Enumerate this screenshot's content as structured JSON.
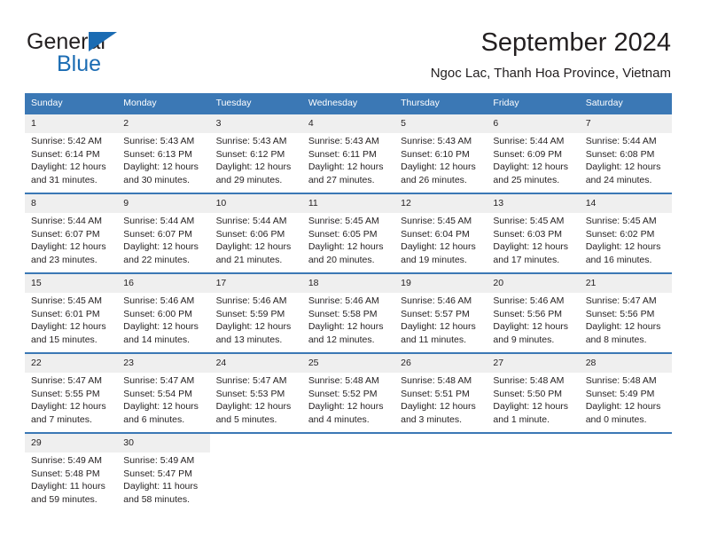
{
  "brand": {
    "word1": "General",
    "word2": "Blue",
    "triangle_color": "#1b6cb3"
  },
  "header": {
    "title": "September 2024",
    "subtitle": "Ngoc Lac, Thanh Hoa Province, Vietnam"
  },
  "theme": {
    "header_bg": "#3b78b5",
    "daynum_bg": "#efefef",
    "text": "#231f20",
    "accent": "#1b6cb3"
  },
  "calendar": {
    "weekday_headers": [
      "Sunday",
      "Monday",
      "Tuesday",
      "Wednesday",
      "Thursday",
      "Friday",
      "Saturday"
    ],
    "weeks": [
      [
        {
          "day": "1",
          "sunrise": "Sunrise: 5:42 AM",
          "sunset": "Sunset: 6:14 PM",
          "daylight1": "Daylight: 12 hours",
          "daylight2": "and 31 minutes."
        },
        {
          "day": "2",
          "sunrise": "Sunrise: 5:43 AM",
          "sunset": "Sunset: 6:13 PM",
          "daylight1": "Daylight: 12 hours",
          "daylight2": "and 30 minutes."
        },
        {
          "day": "3",
          "sunrise": "Sunrise: 5:43 AM",
          "sunset": "Sunset: 6:12 PM",
          "daylight1": "Daylight: 12 hours",
          "daylight2": "and 29 minutes."
        },
        {
          "day": "4",
          "sunrise": "Sunrise: 5:43 AM",
          "sunset": "Sunset: 6:11 PM",
          "daylight1": "Daylight: 12 hours",
          "daylight2": "and 27 minutes."
        },
        {
          "day": "5",
          "sunrise": "Sunrise: 5:43 AM",
          "sunset": "Sunset: 6:10 PM",
          "daylight1": "Daylight: 12 hours",
          "daylight2": "and 26 minutes."
        },
        {
          "day": "6",
          "sunrise": "Sunrise: 5:44 AM",
          "sunset": "Sunset: 6:09 PM",
          "daylight1": "Daylight: 12 hours",
          "daylight2": "and 25 minutes."
        },
        {
          "day": "7",
          "sunrise": "Sunrise: 5:44 AM",
          "sunset": "Sunset: 6:08 PM",
          "daylight1": "Daylight: 12 hours",
          "daylight2": "and 24 minutes."
        }
      ],
      [
        {
          "day": "8",
          "sunrise": "Sunrise: 5:44 AM",
          "sunset": "Sunset: 6:07 PM",
          "daylight1": "Daylight: 12 hours",
          "daylight2": "and 23 minutes."
        },
        {
          "day": "9",
          "sunrise": "Sunrise: 5:44 AM",
          "sunset": "Sunset: 6:07 PM",
          "daylight1": "Daylight: 12 hours",
          "daylight2": "and 22 minutes."
        },
        {
          "day": "10",
          "sunrise": "Sunrise: 5:44 AM",
          "sunset": "Sunset: 6:06 PM",
          "daylight1": "Daylight: 12 hours",
          "daylight2": "and 21 minutes."
        },
        {
          "day": "11",
          "sunrise": "Sunrise: 5:45 AM",
          "sunset": "Sunset: 6:05 PM",
          "daylight1": "Daylight: 12 hours",
          "daylight2": "and 20 minutes."
        },
        {
          "day": "12",
          "sunrise": "Sunrise: 5:45 AM",
          "sunset": "Sunset: 6:04 PM",
          "daylight1": "Daylight: 12 hours",
          "daylight2": "and 19 minutes."
        },
        {
          "day": "13",
          "sunrise": "Sunrise: 5:45 AM",
          "sunset": "Sunset: 6:03 PM",
          "daylight1": "Daylight: 12 hours",
          "daylight2": "and 17 minutes."
        },
        {
          "day": "14",
          "sunrise": "Sunrise: 5:45 AM",
          "sunset": "Sunset: 6:02 PM",
          "daylight1": "Daylight: 12 hours",
          "daylight2": "and 16 minutes."
        }
      ],
      [
        {
          "day": "15",
          "sunrise": "Sunrise: 5:45 AM",
          "sunset": "Sunset: 6:01 PM",
          "daylight1": "Daylight: 12 hours",
          "daylight2": "and 15 minutes."
        },
        {
          "day": "16",
          "sunrise": "Sunrise: 5:46 AM",
          "sunset": "Sunset: 6:00 PM",
          "daylight1": "Daylight: 12 hours",
          "daylight2": "and 14 minutes."
        },
        {
          "day": "17",
          "sunrise": "Sunrise: 5:46 AM",
          "sunset": "Sunset: 5:59 PM",
          "daylight1": "Daylight: 12 hours",
          "daylight2": "and 13 minutes."
        },
        {
          "day": "18",
          "sunrise": "Sunrise: 5:46 AM",
          "sunset": "Sunset: 5:58 PM",
          "daylight1": "Daylight: 12 hours",
          "daylight2": "and 12 minutes."
        },
        {
          "day": "19",
          "sunrise": "Sunrise: 5:46 AM",
          "sunset": "Sunset: 5:57 PM",
          "daylight1": "Daylight: 12 hours",
          "daylight2": "and 11 minutes."
        },
        {
          "day": "20",
          "sunrise": "Sunrise: 5:46 AM",
          "sunset": "Sunset: 5:56 PM",
          "daylight1": "Daylight: 12 hours",
          "daylight2": "and 9 minutes."
        },
        {
          "day": "21",
          "sunrise": "Sunrise: 5:47 AM",
          "sunset": "Sunset: 5:56 PM",
          "daylight1": "Daylight: 12 hours",
          "daylight2": "and 8 minutes."
        }
      ],
      [
        {
          "day": "22",
          "sunrise": "Sunrise: 5:47 AM",
          "sunset": "Sunset: 5:55 PM",
          "daylight1": "Daylight: 12 hours",
          "daylight2": "and 7 minutes."
        },
        {
          "day": "23",
          "sunrise": "Sunrise: 5:47 AM",
          "sunset": "Sunset: 5:54 PM",
          "daylight1": "Daylight: 12 hours",
          "daylight2": "and 6 minutes."
        },
        {
          "day": "24",
          "sunrise": "Sunrise: 5:47 AM",
          "sunset": "Sunset: 5:53 PM",
          "daylight1": "Daylight: 12 hours",
          "daylight2": "and 5 minutes."
        },
        {
          "day": "25",
          "sunrise": "Sunrise: 5:48 AM",
          "sunset": "Sunset: 5:52 PM",
          "daylight1": "Daylight: 12 hours",
          "daylight2": "and 4 minutes."
        },
        {
          "day": "26",
          "sunrise": "Sunrise: 5:48 AM",
          "sunset": "Sunset: 5:51 PM",
          "daylight1": "Daylight: 12 hours",
          "daylight2": "and 3 minutes."
        },
        {
          "day": "27",
          "sunrise": "Sunrise: 5:48 AM",
          "sunset": "Sunset: 5:50 PM",
          "daylight1": "Daylight: 12 hours",
          "daylight2": "and 1 minute."
        },
        {
          "day": "28",
          "sunrise": "Sunrise: 5:48 AM",
          "sunset": "Sunset: 5:49 PM",
          "daylight1": "Daylight: 12 hours",
          "daylight2": "and 0 minutes."
        }
      ],
      [
        {
          "day": "29",
          "sunrise": "Sunrise: 5:49 AM",
          "sunset": "Sunset: 5:48 PM",
          "daylight1": "Daylight: 11 hours",
          "daylight2": "and 59 minutes."
        },
        {
          "day": "30",
          "sunrise": "Sunrise: 5:49 AM",
          "sunset": "Sunset: 5:47 PM",
          "daylight1": "Daylight: 11 hours",
          "daylight2": "and 58 minutes."
        },
        {
          "day": "",
          "sunrise": "",
          "sunset": "",
          "daylight1": "",
          "daylight2": ""
        },
        {
          "day": "",
          "sunrise": "",
          "sunset": "",
          "daylight1": "",
          "daylight2": ""
        },
        {
          "day": "",
          "sunrise": "",
          "sunset": "",
          "daylight1": "",
          "daylight2": ""
        },
        {
          "day": "",
          "sunrise": "",
          "sunset": "",
          "daylight1": "",
          "daylight2": ""
        },
        {
          "day": "",
          "sunrise": "",
          "sunset": "",
          "daylight1": "",
          "daylight2": ""
        }
      ]
    ]
  }
}
